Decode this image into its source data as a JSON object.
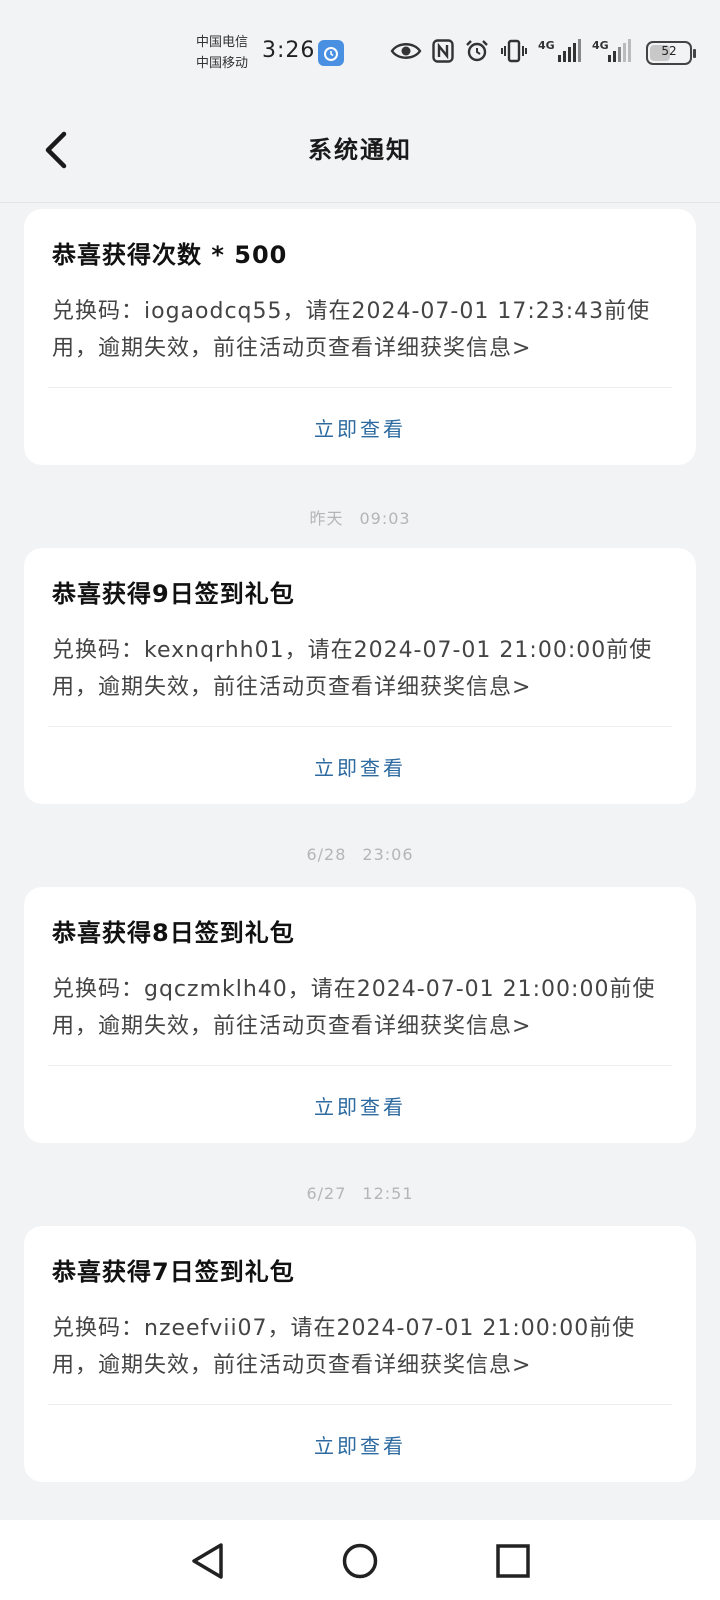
{
  "status_bar": {
    "carrier_1": "中国电信",
    "carrier_2": "中国移动",
    "time": "3:26",
    "network_1": "4G",
    "network_2": "4G",
    "battery_level": "52"
  },
  "header": {
    "title": "系统通知"
  },
  "notifications": [
    {
      "title": "恭喜获得次数 * 500",
      "body": "兑换码：iogaodcq55，请在2024-07-01 17:23:43前使用，逾期失效，前往活动页查看详细获奖信息>",
      "action_label": "立即查看"
    },
    {
      "timestamp_day": "昨天",
      "timestamp_time": "09:03",
      "title": "恭喜获得9日签到礼包",
      "body": "兑换码：kexnqrhh01，请在2024-07-01 21:00:00前使用，逾期失效，前往活动页查看详细获奖信息>",
      "action_label": "立即查看"
    },
    {
      "timestamp_day": "6/28",
      "timestamp_time": "23:06",
      "title": "恭喜获得8日签到礼包",
      "body": "兑换码：gqczmklh40，请在2024-07-01 21:00:00前使用，逾期失效，前往活动页查看详细获奖信息>",
      "action_label": "立即查看"
    },
    {
      "timestamp_day": "6/27",
      "timestamp_time": "12:51",
      "title": "恭喜获得7日签到礼包",
      "body": "兑换码：nzeefvii07，请在2024-07-01 21:00:00前使用，逾期失效，前往活动页查看详细获奖信息>",
      "action_label": "立即查看"
    }
  ],
  "colors": {
    "background": "#f2f3f5",
    "card": "#ffffff",
    "action_link": "#2c6aa0",
    "timestamp": "#b5b5b5"
  },
  "icons": {
    "back": "chevron-left-icon",
    "nav_back": "triangle-back-icon",
    "nav_home": "circle-home-icon",
    "nav_recents": "square-recents-icon"
  }
}
